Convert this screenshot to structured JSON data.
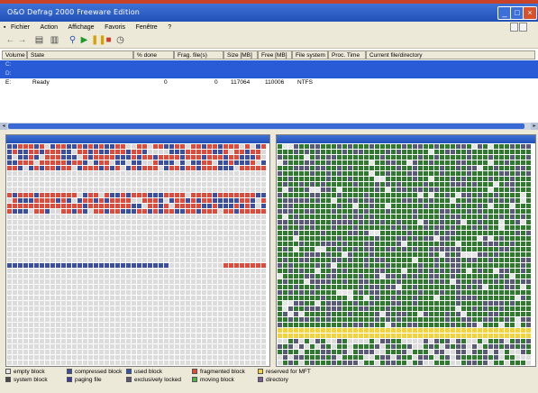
{
  "window": {
    "title": "O&O Defrag 2000 Freeware Edition"
  },
  "menu": [
    "Fichier",
    "Action",
    "Affichage",
    "Favoris",
    "Fenêtre",
    "?"
  ],
  "toolbar": {
    "icons": [
      "back-icon",
      "forward-icon",
      "properties-icon",
      "settings-icon",
      "analyze-icon",
      "start-icon",
      "pause-icon",
      "stop-icon",
      "schedule-icon"
    ]
  },
  "volume_list": {
    "columns": [
      "Volume",
      "State",
      "% done",
      "Frag. file(s)",
      "Size [MB]",
      "Free [MB]",
      "File system",
      "Proc. Time",
      "Current file/directory"
    ],
    "rows": [
      {
        "volume": "C:",
        "state": "",
        "done": "",
        "frag": "",
        "size": "",
        "free": "",
        "fs": "",
        "time": "",
        "current": "",
        "selected": true
      },
      {
        "volume": "D:",
        "state": "",
        "done": "",
        "frag": "",
        "size": "",
        "free": "",
        "fs": "",
        "time": "",
        "current": "",
        "selected": true
      },
      {
        "volume": "E:",
        "state": "Ready",
        "done": "0",
        "frag": "0",
        "size": "117064",
        "free": "110006",
        "fs": "NTFS",
        "time": "",
        "current": "",
        "selected": false
      }
    ]
  },
  "panels": {
    "left_title": "",
    "right_title": ""
  },
  "legend": [
    {
      "label": "empty block",
      "color": "#e6e6e6"
    },
    {
      "label": "system block",
      "color": "#4a4a4a"
    },
    {
      "label": "compressed block",
      "color": "#3b4fa0"
    },
    {
      "label": "paging file",
      "color": "#3a3fa8"
    },
    {
      "label": "used block",
      "color": "#2c55b4"
    },
    {
      "label": "exclusively locked",
      "color": "#5a5a78"
    },
    {
      "label": "fragmented block",
      "color": "#e04a3a"
    },
    {
      "label": "moving block",
      "color": "#4bb54b"
    },
    {
      "label": "reserved for MFT",
      "color": "#f2d33a"
    },
    {
      "label": "directory",
      "color": "#7a5a9a"
    }
  ]
}
